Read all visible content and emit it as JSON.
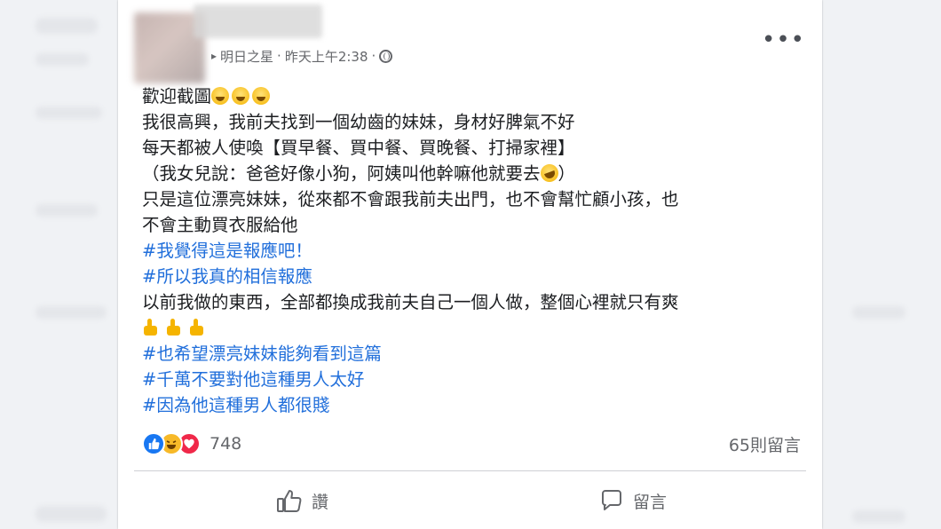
{
  "post": {
    "group_name": "明日之星",
    "timestamp": "昨天上午2:38",
    "separator": "·",
    "more_icon": "•••",
    "lines": [
      {
        "text": "歡迎截圖",
        "tag": false,
        "emoji": "grinning-face",
        "emoji_count": 3
      },
      {
        "text": "我很高興，我前夫找到一個幼齒的妹妹，身材好脾氣不好",
        "tag": false
      },
      {
        "text": "每天都被人使喚【買早餐、買中餐、買晚餐、打掃家裡】",
        "tag": false
      },
      {
        "text_before": "（我女兒說：爸爸好像小狗，阿姨叫他幹嘛他就要去",
        "text_after": "）",
        "tag": false,
        "emoji": "rolling-laughing-face"
      },
      {
        "text": "只是這位漂亮妹妹，從來都不會跟我前夫出門，也不會幫忙顧小孩，也",
        "tag": false
      },
      {
        "text": "不會主動買衣服給他",
        "tag": false
      },
      {
        "text": "#我覺得這是報應吧！",
        "tag": true
      },
      {
        "text": "#所以我真的相信報應",
        "tag": true
      },
      {
        "text": "以前我做的東西，全部都換成我前夫自己一個人做，整個心裡就只有爽",
        "tag": false
      },
      {
        "text": "",
        "tag": false,
        "emoji": "thumbs-up",
        "emoji_count": 3
      },
      {
        "text": "#也希望漂亮妹妹能夠看到這篇",
        "tag": true
      },
      {
        "text": "#千萬不要對他這種男人太好",
        "tag": true
      },
      {
        "text": "#因為他這種男人都很賤",
        "tag": true
      }
    ],
    "reactions": {
      "icons": [
        "like-icon",
        "haha-icon",
        "love-icon"
      ],
      "count": "748"
    },
    "comments_count": "65則留言",
    "actions": {
      "like_label": "讚",
      "comment_label": "留言"
    },
    "colors": {
      "hashtag": "#216fdb",
      "text": "#1c1e21",
      "meta": "#65676b",
      "like_blue": "#1877f2",
      "love_red": "#f02849",
      "haha_yellow": "#f7b928"
    }
  }
}
